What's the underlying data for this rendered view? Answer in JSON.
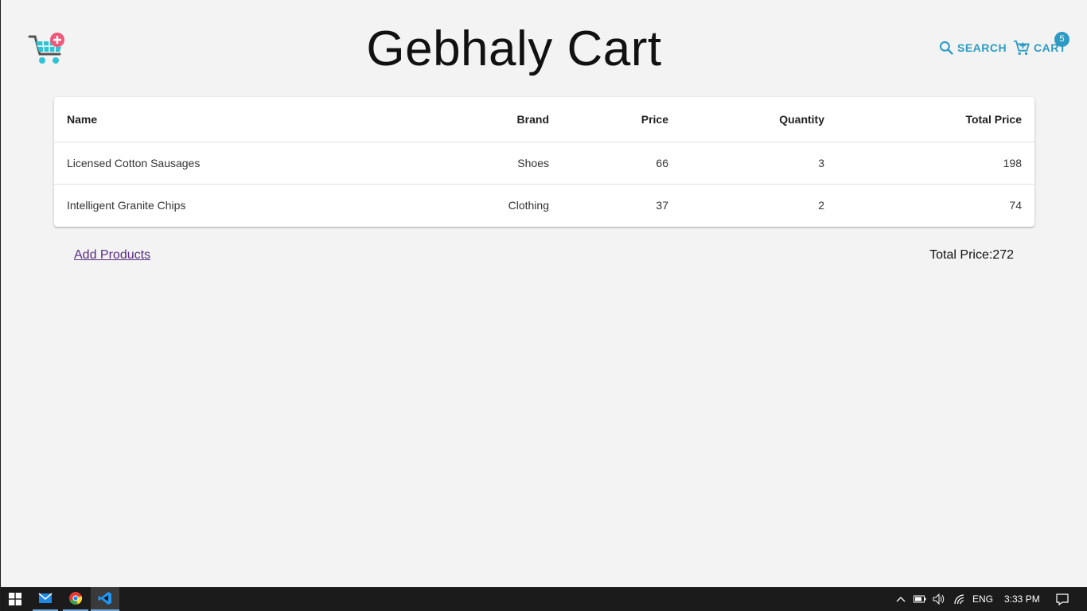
{
  "header": {
    "title": "Gebhaly Cart",
    "search_label": "SEARCH",
    "cart_label": "CART",
    "cart_count": "5",
    "accent_color": "#2e9bc4"
  },
  "table": {
    "columns": [
      "Name",
      "Brand",
      "Price",
      "Quantity",
      "Total Price"
    ],
    "rows": [
      [
        "Licensed Cotton Sausages",
        "Shoes",
        "66",
        "3",
        "198"
      ],
      [
        "Intelligent Granite Chips",
        "Clothing",
        "37",
        "2",
        "74"
      ]
    ]
  },
  "footer": {
    "add_products_label": "Add Products",
    "total_text": "Total Price:272"
  },
  "taskbar": {
    "language": "ENG",
    "time": "3:33 PM",
    "icons": [
      "windows-start-icon",
      "mail-icon",
      "chrome-icon",
      "vscode-icon",
      "chevron-up-icon",
      "battery-icon",
      "volume-icon",
      "wifi-icon",
      "notification-icon"
    ]
  }
}
